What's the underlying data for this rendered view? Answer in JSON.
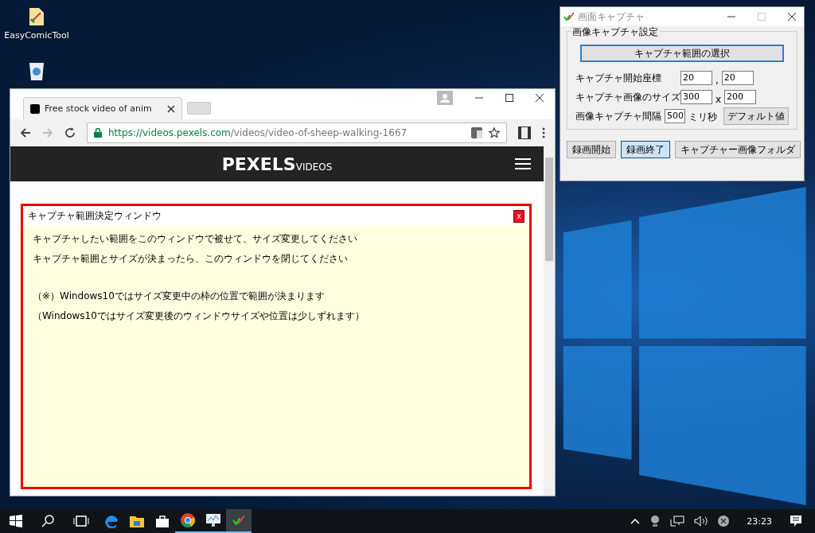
{
  "desktop_icons": [
    {
      "label": "EasyComicTool",
      "kind": "folder"
    },
    {
      "kind": "recycle"
    }
  ],
  "browser": {
    "tab_title": "Free stock video of anim",
    "url_host": "https://videos.pexels.com",
    "url_path": "/videos/video-of-sheep-walking-1667",
    "logo": "PEXELS",
    "logo_sub": "VIDEOS"
  },
  "capture_window": {
    "title": "キャプチャ範囲決定ウィンドウ",
    "close_label": "x",
    "paragraphs": [
      [
        "キャプチャしたい範囲をこのウィンドウで被せて、サイズ変更してください",
        "キャプチャ範囲とサイズが決まったら、このウィンドウを閉じてください"
      ],
      [
        "（※）Windows10ではサイズ変更中の枠の位置で範囲が決まります",
        "（Windows10ではサイズ変更後のウィンドウサイズや位置は少しずれます）"
      ]
    ]
  },
  "app_window": {
    "title": "画面キャプチャ",
    "group_label": "画像キャプチャ設定",
    "select_button": "キャプチャ範囲の選択",
    "rows": [
      {
        "kind": "pair",
        "label": "キャプチャ開始座標",
        "value1": "20",
        "separator": ",",
        "value2": "20"
      },
      {
        "kind": "pair",
        "label": "キャプチャ画像のサイズ",
        "value1": "300",
        "separator": "x",
        "value2": "200"
      },
      {
        "kind": "single",
        "label": "画像キャプチャ間隔",
        "value1": "500",
        "unit": "ミリ秒",
        "button": "デフォルト値"
      }
    ],
    "buttons": [
      {
        "label": "録画開始",
        "focused": false
      },
      {
        "label": "録画終了",
        "focused": true
      },
      {
        "label": "キャプチャー画像フォルダ",
        "focused": false
      }
    ]
  },
  "taskbar": {
    "apps": [
      {
        "kind": "edge",
        "running": false,
        "active": false
      },
      {
        "kind": "explorer",
        "running": false,
        "active": false
      },
      {
        "kind": "store",
        "running": false,
        "active": false
      },
      {
        "kind": "chrome",
        "running": true,
        "active": false
      },
      {
        "kind": "monitor",
        "running": true,
        "active": false
      },
      {
        "kind": "capture",
        "running": true,
        "active": true
      }
    ],
    "clock": "23:23"
  }
}
